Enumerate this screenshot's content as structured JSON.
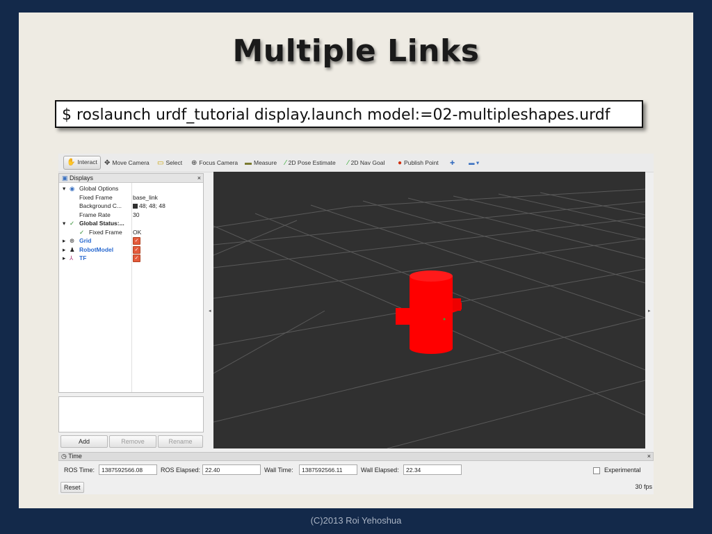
{
  "slide": {
    "title": "Multiple Links",
    "command": "$ roslaunch urdf_tutorial display.launch model:=02-multipleshapes.urdf",
    "footer": "(C)2013 Roi Yehoshua"
  },
  "toolbar": {
    "interact": "Interact",
    "move_camera": "Move Camera",
    "select": "Select",
    "focus_camera": "Focus Camera",
    "measure": "Measure",
    "pose_estimate": "2D Pose Estimate",
    "nav_goal": "2D Nav Goal",
    "publish_point": "Publish Point"
  },
  "displays": {
    "title": "Displays",
    "close": "×",
    "global_options": "Global Options",
    "fixed_frame_label": "Fixed Frame",
    "fixed_frame_value": "base_link",
    "background_label": "Background C...",
    "background_value": "48; 48; 48",
    "frame_rate_label": "Frame Rate",
    "frame_rate_value": "30",
    "global_status": "Global Status:...",
    "status_fixed_frame": "Fixed Frame",
    "status_fixed_frame_value": "OK",
    "grid": "Grid",
    "robot_model": "RobotModel",
    "tf": "TF",
    "add": "Add",
    "remove": "Remove",
    "rename": "Rename"
  },
  "time": {
    "title": "Time",
    "close": "×",
    "ros_time_label": "ROS Time:",
    "ros_time": "1387592566.08",
    "ros_elapsed_label": "ROS Elapsed:",
    "ros_elapsed": "22.40",
    "wall_time_label": "Wall Time:",
    "wall_time": "1387592566.11",
    "wall_elapsed_label": "Wall Elapsed:",
    "wall_elapsed": "22.34",
    "experimental": "Experimental",
    "reset": "Reset",
    "fps": "30 fps"
  },
  "colors": {
    "background": "#13294a",
    "slide": "#eeebe3",
    "viewport": "#303030",
    "robot": "#ff0000"
  }
}
